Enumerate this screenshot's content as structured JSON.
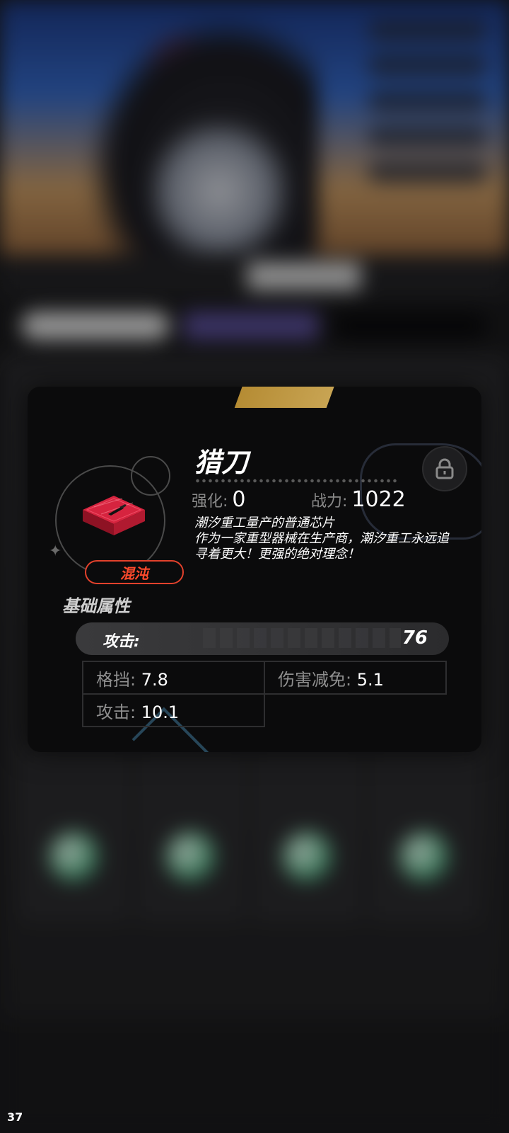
{
  "item": {
    "name": "猎刀",
    "rarity": "混沌",
    "enhance_label": "强化:",
    "enhance_value": "0",
    "power_label": "战力:",
    "power_value": "1022",
    "description_line1": "潮汐重工量产的普通芯片",
    "description_line2": "作为一家重型器械在生产商，潮汐重工永远追寻着更大！更强的绝对理念！"
  },
  "base_attributes": {
    "title": "基础属性",
    "main_stat_label": "攻击:",
    "main_stat_value": "76"
  },
  "sub_stats": [
    {
      "label": "格挡:",
      "value": "7.8"
    },
    {
      "label": "伤害减免:",
      "value": "5.1"
    },
    {
      "label": "攻击:",
      "value": "10.1"
    }
  ],
  "overlay": {
    "fps": "37"
  },
  "colors": {
    "rarity_accent": "#e2412c",
    "chip_red": "#d6243f",
    "panel_bg": "#0b0b0c"
  },
  "icons": [
    "lock-icon",
    "chip-icon",
    "sparkle-icon"
  ]
}
